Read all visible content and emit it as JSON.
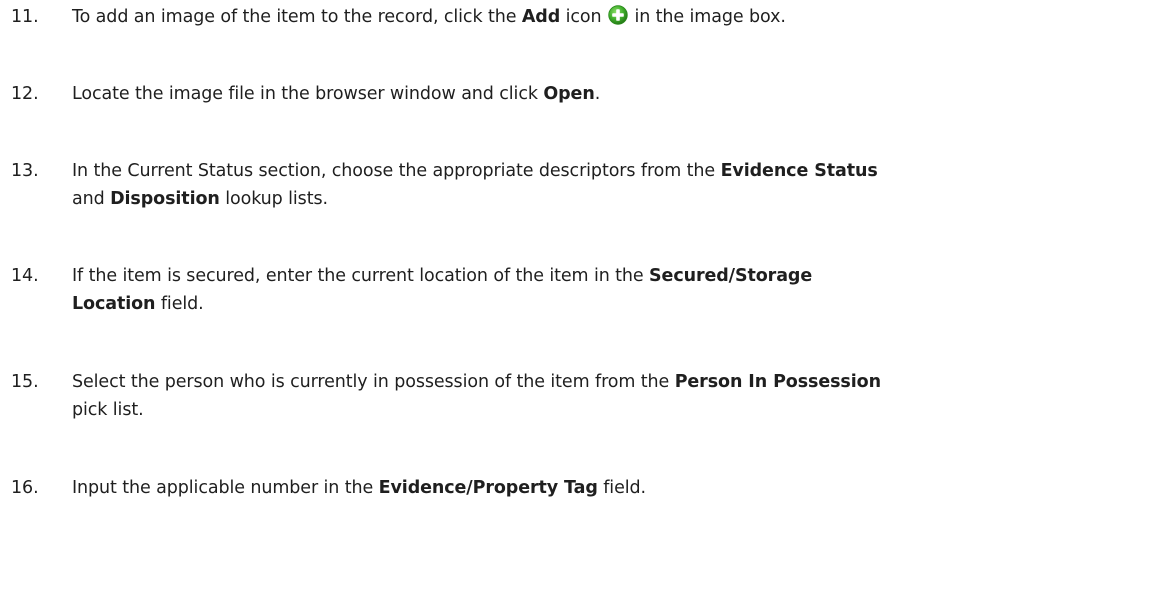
{
  "steps": [
    {
      "number": "11.",
      "before": "To add an image of the item to the record, click the ",
      "bold1": "Add",
      "middle": " icon",
      "icon": "add-icon",
      "after": " in the image box."
    },
    {
      "number": "12.",
      "before": "Locate the image file in the browser window and click ",
      "bold1": "Open",
      "after": "."
    },
    {
      "number": "13.",
      "before": "In the Current Status section, choose the appropriate descriptors from the ",
      "bold1": "Evidence Status",
      "middle": "and ",
      "bold2": "Disposition",
      "after": " lookup lists."
    },
    {
      "number": "14.",
      "before": "If the item is secured, enter the current location of the item in the ",
      "bold1": "Secured/Storage",
      "bold2": "Location",
      "after": " field."
    },
    {
      "number": "15.",
      "before": "Select the person who is currently in possession of the item from the ",
      "bold1": "Person In Possession",
      "after": "pick list."
    },
    {
      "number": "16.",
      "before": "Input the applicable number in the ",
      "bold1": "Evidence/Property Tag",
      "after": " field."
    }
  ],
  "colors": {
    "text": "#1f1f1f",
    "add_icon_green": "#3fae2a"
  }
}
